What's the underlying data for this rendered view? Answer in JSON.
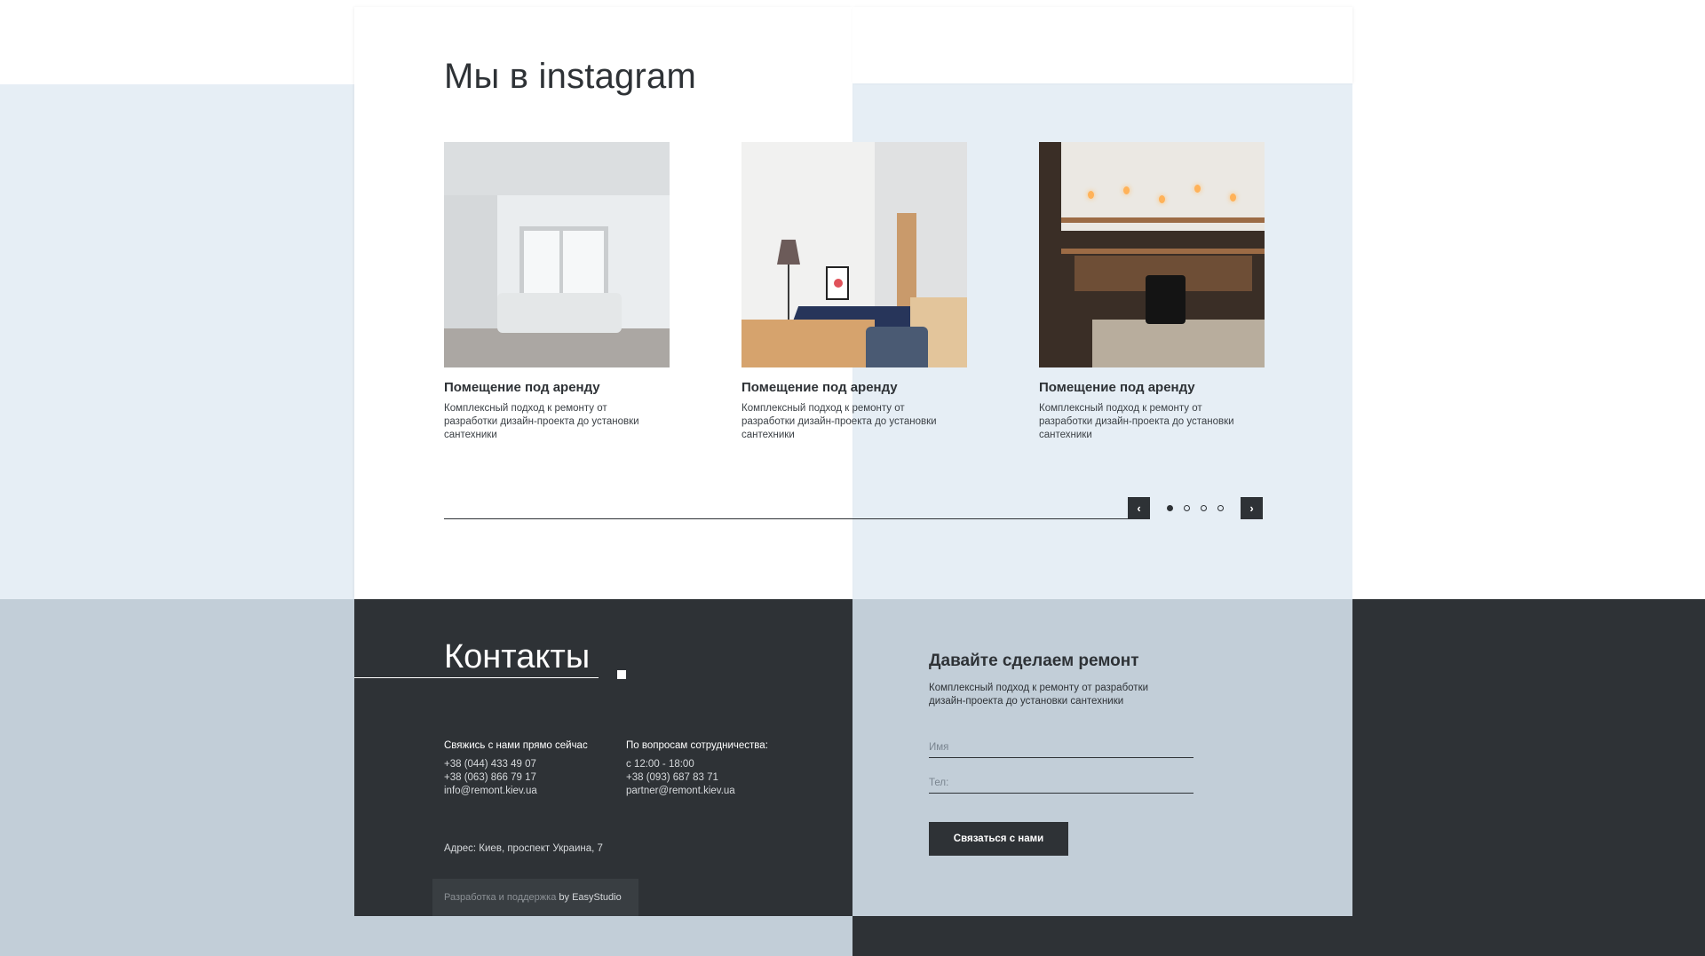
{
  "instagram": {
    "title": "Мы в instagram",
    "cards": [
      {
        "title": "Помещение под аренду",
        "text": "Комплексный подход к ремонту от разработки дизайн-проекта до установки сантехники"
      },
      {
        "title": "Помещение под аренду",
        "text": "Комплексный подход к ремонту от разработки дизайн-проекта до установки сантехники"
      },
      {
        "title": "Помещение под аренду",
        "text": "Комплексный подход к ремонту от разработки дизайн-проекта до установки сантехники"
      }
    ],
    "slider": {
      "prev_icon": "chevron-left-icon",
      "next_icon": "chevron-right-icon",
      "prev_glyph": "‹",
      "next_glyph": "›",
      "page_count": 4,
      "active_page": 1
    }
  },
  "contacts": {
    "title": "Контакты",
    "col1": {
      "heading": "Свяжись с нами прямо сейчас",
      "lines": [
        "+38 (044) 433 49 07",
        "+38 (063) 866 79 17",
        "info@remont.kiev.ua"
      ]
    },
    "col2": {
      "heading": "По вопросам сотрудничества:",
      "lines": [
        "с 12:00 - 18:00",
        "+38 (093) 687 83 71",
        "partner@remont.kiev.ua"
      ]
    },
    "address": "Адрес: Киев, проспект Украина, 7",
    "credits": {
      "text": "Разработка и поддержка",
      "brand": "by EasyStudio"
    }
  },
  "form": {
    "title": "Давайте сделаем ремонт",
    "text": "Комплексный подход к ремонту от разработки дизайн-проекта до установки сантехники",
    "name_placeholder": "Имя",
    "tel_placeholder": "Тел:",
    "submit_label": "Связаться с нами"
  },
  "colors": {
    "dark": "#2e3236",
    "light_blue": "#e6eef5",
    "gray_blue": "#c2ced8",
    "white": "#ffffff"
  }
}
